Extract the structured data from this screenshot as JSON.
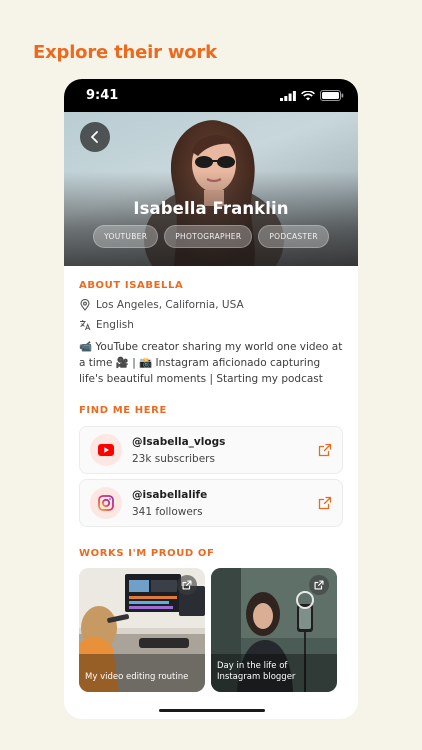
{
  "headline": "Explore their work",
  "status": {
    "time": "9:41"
  },
  "profile": {
    "name": "Isabella Franklin",
    "tags": [
      "YOUTUBER",
      "PHOTOGRAPHER",
      "PODCASTER"
    ]
  },
  "about": {
    "title": "ABOUT ISABELLA",
    "location": "Los Angeles, California, USA",
    "language": "English",
    "bio": "📹 YouTube creator sharing my world one video at a time 🎥 | 📸 Instagram aficionado capturing life's beautiful moments | Starting my podcast"
  },
  "find_me": {
    "title": "FIND ME HERE",
    "links": [
      {
        "platform": "youtube",
        "handle": "@Isabella_vlogs",
        "count": "23k subscribers",
        "icon": "youtube-icon"
      },
      {
        "platform": "instagram",
        "handle": "@isabellalife",
        "count": "341 followers",
        "icon": "instagram-icon"
      }
    ]
  },
  "works": {
    "title": "WORKS I'M PROUD OF",
    "items": [
      {
        "caption": "My video editing routine"
      },
      {
        "caption": "Day in the life of Instagram blogger"
      }
    ]
  },
  "colors": {
    "accent": "#ec6a1e",
    "background": "#f6f3e8",
    "youtube": "#ff0000",
    "instagram": "#c13584"
  }
}
